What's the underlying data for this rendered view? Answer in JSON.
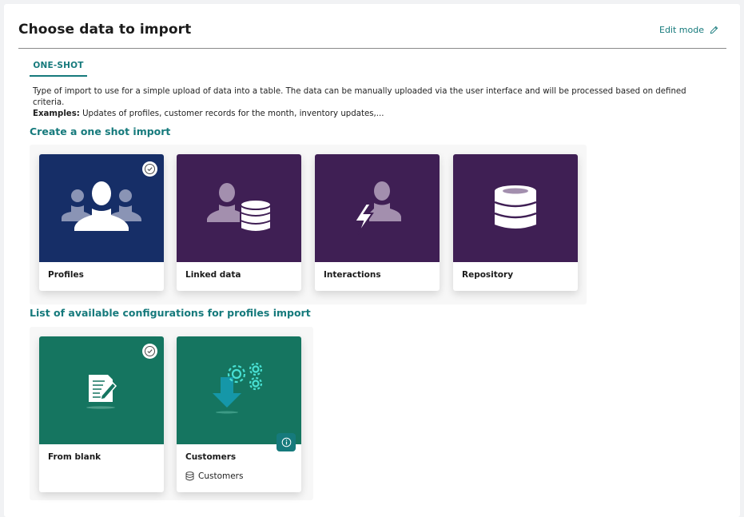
{
  "header": {
    "title": "Choose data to import",
    "edit_label": "Edit mode"
  },
  "tabs": [
    {
      "label": "ONE-SHOT"
    }
  ],
  "description": {
    "text": "Type of import to use for a simple upload of data into a table. The data can be manually uploaded via the user interface and will be processed based on defined criteria.",
    "examples_label": "Examples:",
    "examples_text": " Updates of profiles, customer records for the month, inventory updates,..."
  },
  "create_section": {
    "title": "Create a one shot import",
    "cards": [
      {
        "label": "Profiles",
        "icon": "profiles-icon",
        "color": "#162e67",
        "selected": true
      },
      {
        "label": "Linked data",
        "icon": "linked-data-icon",
        "color": "#3f1f54",
        "selected": false
      },
      {
        "label": "Interactions",
        "icon": "interactions-icon",
        "color": "#3f1f54",
        "selected": false
      },
      {
        "label": "Repository",
        "icon": "repository-icon",
        "color": "#3f1f54",
        "selected": false
      }
    ]
  },
  "config_section": {
    "title": "List of available configurations for profiles import",
    "cards": [
      {
        "label": "From blank",
        "icon": "document-edit-icon",
        "color": "#157560",
        "selected": true
      },
      {
        "label": "Customers",
        "icon": "gears-download-icon",
        "color": "#157560",
        "selected": false,
        "sub_label": "Customers",
        "sub_icon": "database-icon",
        "info_icon": "info-icon"
      }
    ]
  },
  "colors": {
    "accent": "#167a7c",
    "navy": "#162e67",
    "purple": "#3f1f54",
    "green": "#157560"
  }
}
